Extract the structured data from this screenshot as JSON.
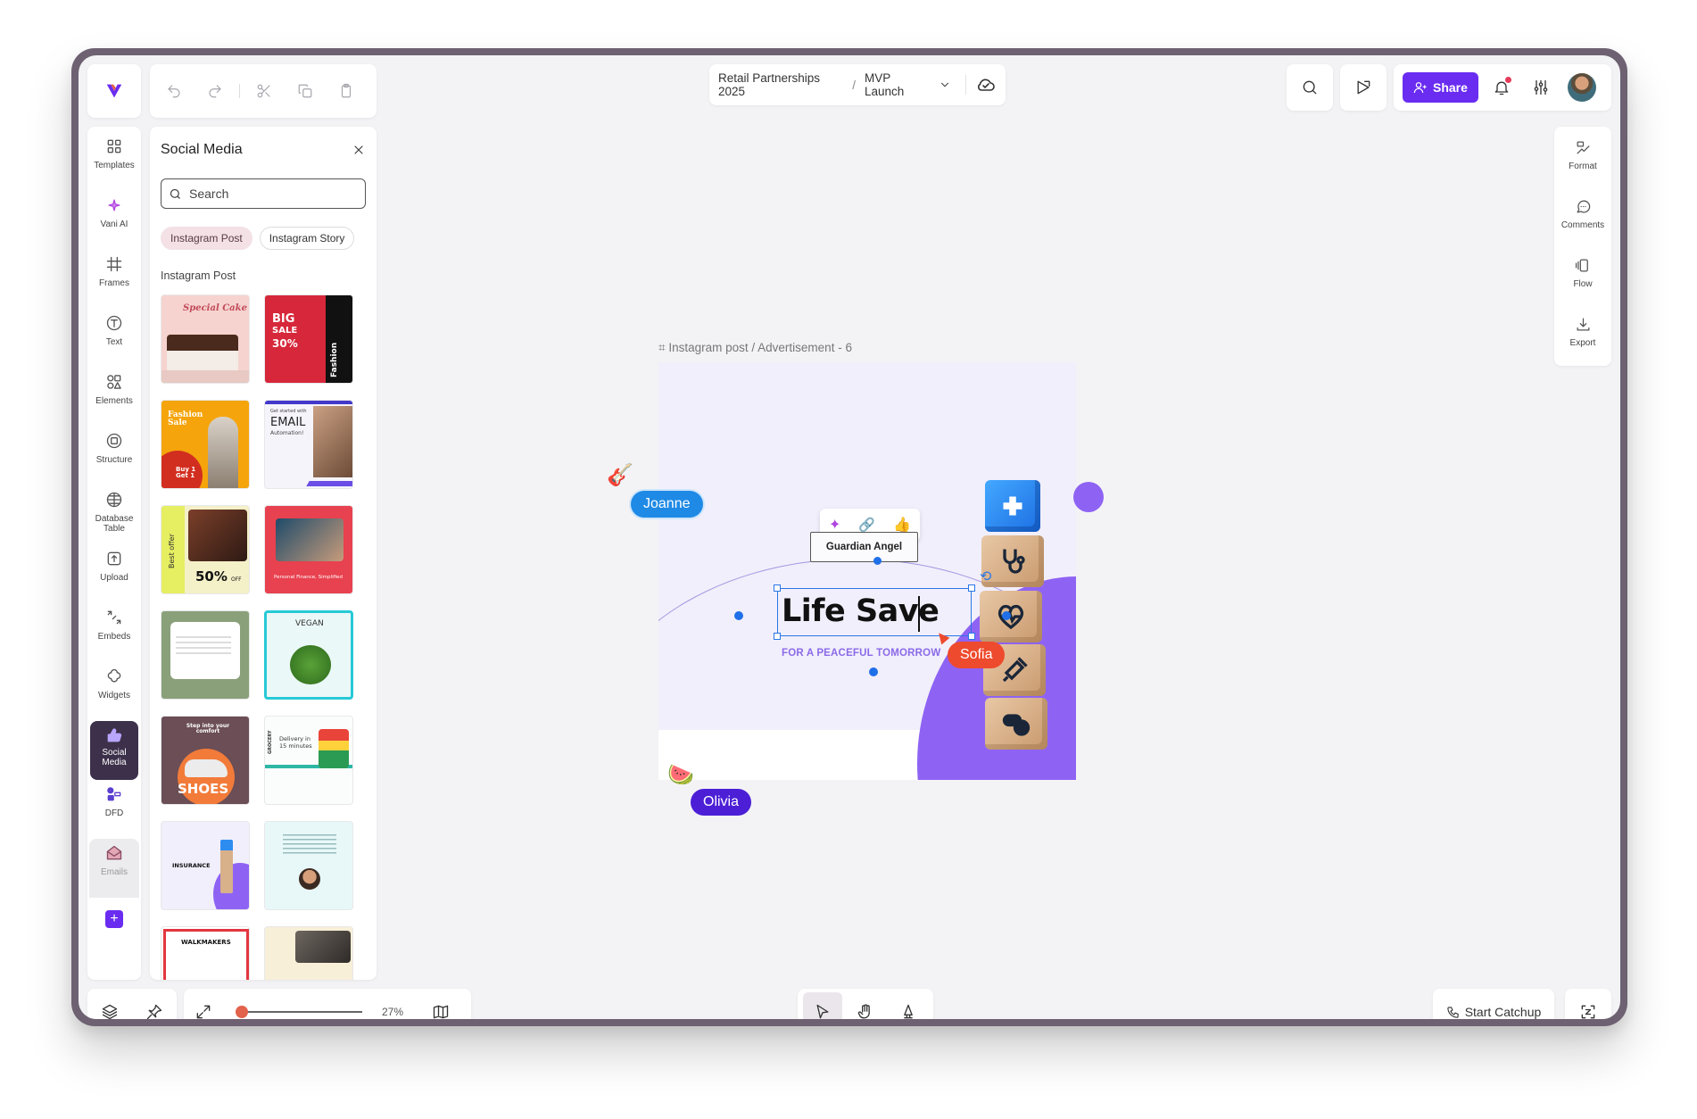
{
  "breadcrumb": {
    "project": "Retail Partnerships 2025",
    "separator": "/",
    "page": "MVP Launch"
  },
  "header": {
    "share_label": "Share"
  },
  "rail": [
    {
      "id": "templates",
      "label": "Templates",
      "icon": "grid-icon"
    },
    {
      "id": "vani-ai",
      "label": "Vani AI",
      "icon": "sparkle-icon"
    },
    {
      "id": "frames",
      "label": "Frames",
      "icon": "hash-icon"
    },
    {
      "id": "text",
      "label": "Text",
      "icon": "text-icon"
    },
    {
      "id": "elements",
      "label": "Elements",
      "icon": "shapes-icon"
    },
    {
      "id": "structure",
      "label": "Structure",
      "icon": "structure-icon"
    },
    {
      "id": "database-table",
      "label": "Database Table",
      "icon": "database-icon"
    },
    {
      "id": "upload",
      "label": "Upload",
      "icon": "upload-icon"
    },
    {
      "id": "embeds",
      "label": "Embeds",
      "icon": "embed-icon"
    },
    {
      "id": "widgets",
      "label": "Widgets",
      "icon": "widget-icon"
    },
    {
      "id": "social-media",
      "label": "Social Media",
      "icon": "thumbs-up-icon",
      "active": true
    },
    {
      "id": "dfd",
      "label": "DFD",
      "icon": "dfd-icon"
    },
    {
      "id": "emails",
      "label": "Emails",
      "icon": "mail-icon"
    }
  ],
  "panel": {
    "title": "Social Media",
    "search_placeholder": "Search",
    "chips": [
      {
        "label": "Instagram Post",
        "active": true
      },
      {
        "label": "Instagram Story",
        "active": false
      }
    ],
    "section_label": "Instagram Post",
    "thumbs": {
      "t1": "Special Cake",
      "t2_big": "BIG",
      "t2_sale": "SALE",
      "t2_pct": "30%",
      "t2_side": "Fashion",
      "t3_title": "Fashion Sale",
      "t3_sub": "Buy 1 Get 1",
      "t4_a": "Get started with",
      "t4_b": "EMAIL",
      "t4_c": "Automation!",
      "t5_side": "Best offer",
      "t5_pct": "50%",
      "t5_off": "OFF",
      "t6": "Personal Finance, Simplified",
      "t8": "VEGAN",
      "t9_a": "Step into your comfort",
      "t9_b": "SHOES",
      "t10_side": "GROCERY",
      "t10_a": "Delivery in",
      "t10_b": "15 minutes",
      "t11": "INSURANCE",
      "t13": "WALKMAKERS"
    }
  },
  "right_rail": [
    {
      "id": "format",
      "label": "Format",
      "icon": "format-icon"
    },
    {
      "id": "comments",
      "label": "Comments",
      "icon": "comment-icon"
    },
    {
      "id": "flow",
      "label": "Flow",
      "icon": "flow-icon"
    },
    {
      "id": "export",
      "label": "Export",
      "icon": "download-icon"
    }
  ],
  "canvas": {
    "frame_label": "Instagram post / Advertisement - 6",
    "badge_text": "Guardian Angel",
    "headline": "Life Save",
    "tagline": "FOR A PEACEFUL TOMORROW",
    "float_toolbar": [
      "ai-sticker-icon",
      "link-icon",
      "thumbs-up-icon"
    ]
  },
  "collaborators": [
    {
      "name": "Joanne",
      "color": "#1f8ae6",
      "emoji": "🎸"
    },
    {
      "name": "Sofia",
      "color": "#ee4a2d"
    },
    {
      "name": "Olivia",
      "color": "#4c1fd6",
      "emoji": "🍉"
    }
  ],
  "bottom": {
    "zoom_level": "27%",
    "zoom_fraction": 0.0,
    "catchup_label": "Start Catchup"
  },
  "colors": {
    "accent": "#6a2cf0",
    "rail_active": "#3c304a"
  }
}
